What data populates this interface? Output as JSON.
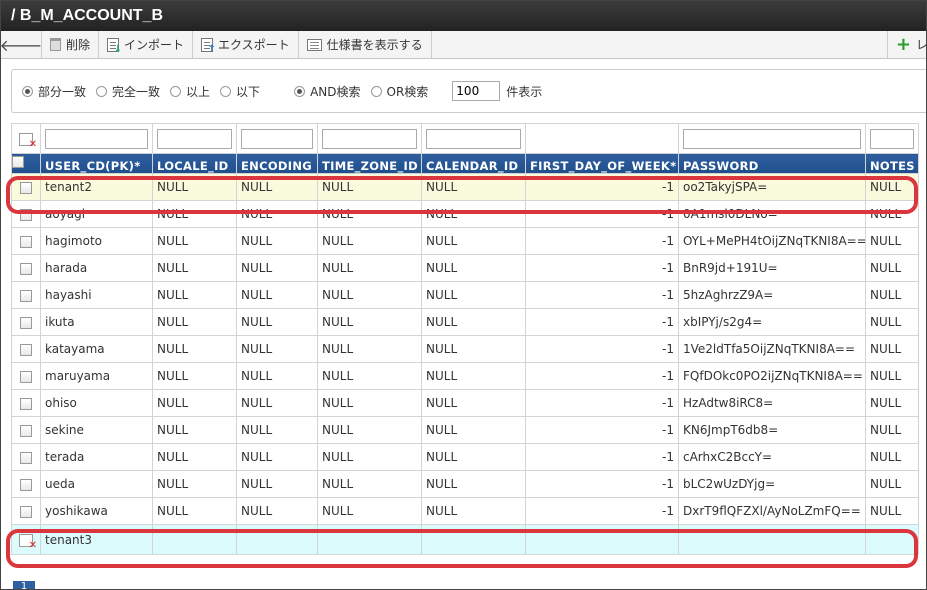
{
  "title": "/ B_M_ACCOUNT_B",
  "toolbar": {
    "delete": "削除",
    "import": "インポート",
    "export": "エクスポート",
    "spec": "仕様書を表示する",
    "add": "レ"
  },
  "search": {
    "options": [
      "部分一致",
      "完全一致",
      "以上",
      "以下"
    ],
    "logic": [
      "AND検索",
      "OR検索"
    ],
    "count_value": "100",
    "count_label": "件表示"
  },
  "columns": [
    "USER_CD(PK)*",
    "LOCALE_ID",
    "ENCODING",
    "TIME_ZONE_ID",
    "CALENDAR_ID",
    "FIRST_DAY_OF_WEEK*",
    "PASSWORD",
    "NOTES"
  ],
  "rows": [
    {
      "user": "tenant2",
      "locale": "NULL",
      "encoding": "NULL",
      "tz": "NULL",
      "cal": "NULL",
      "fdow": "-1",
      "password": "oo2TakyjSPA=",
      "notes": "NULL"
    },
    {
      "user": "aoyagi",
      "locale": "NULL",
      "encoding": "NULL",
      "tz": "NULL",
      "cal": "NULL",
      "fdow": "-1",
      "password": "0A1msl0DLNo=",
      "notes": "NULL"
    },
    {
      "user": "hagimoto",
      "locale": "NULL",
      "encoding": "NULL",
      "tz": "NULL",
      "cal": "NULL",
      "fdow": "-1",
      "password": "OYL+MePH4tOijZNqTKNI8A==",
      "notes": "NULL"
    },
    {
      "user": "harada",
      "locale": "NULL",
      "encoding": "NULL",
      "tz": "NULL",
      "cal": "NULL",
      "fdow": "-1",
      "password": "BnR9jd+191U=",
      "notes": "NULL"
    },
    {
      "user": "hayashi",
      "locale": "NULL",
      "encoding": "NULL",
      "tz": "NULL",
      "cal": "NULL",
      "fdow": "-1",
      "password": "5hzAghrzZ9A=",
      "notes": "NULL"
    },
    {
      "user": "ikuta",
      "locale": "NULL",
      "encoding": "NULL",
      "tz": "NULL",
      "cal": "NULL",
      "fdow": "-1",
      "password": "xbIPYj/s2g4=",
      "notes": "NULL"
    },
    {
      "user": "katayama",
      "locale": "NULL",
      "encoding": "NULL",
      "tz": "NULL",
      "cal": "NULL",
      "fdow": "-1",
      "password": "1Ve2ldTfa5OijZNqTKNI8A==",
      "notes": "NULL"
    },
    {
      "user": "maruyama",
      "locale": "NULL",
      "encoding": "NULL",
      "tz": "NULL",
      "cal": "NULL",
      "fdow": "-1",
      "password": "FQfDOkc0PO2ijZNqTKNI8A==",
      "notes": "NULL"
    },
    {
      "user": "ohiso",
      "locale": "NULL",
      "encoding": "NULL",
      "tz": "NULL",
      "cal": "NULL",
      "fdow": "-1",
      "password": "HzAdtw8iRC8=",
      "notes": "NULL"
    },
    {
      "user": "sekine",
      "locale": "NULL",
      "encoding": "NULL",
      "tz": "NULL",
      "cal": "NULL",
      "fdow": "-1",
      "password": "KN6JmpT6db8=",
      "notes": "NULL"
    },
    {
      "user": "terada",
      "locale": "NULL",
      "encoding": "NULL",
      "tz": "NULL",
      "cal": "NULL",
      "fdow": "-1",
      "password": "cArhxC2BccY=",
      "notes": "NULL"
    },
    {
      "user": "ueda",
      "locale": "NULL",
      "encoding": "NULL",
      "tz": "NULL",
      "cal": "NULL",
      "fdow": "-1",
      "password": "bLC2wUzDYjg=",
      "notes": "NULL"
    },
    {
      "user": "yoshikawa",
      "locale": "NULL",
      "encoding": "NULL",
      "tz": "NULL",
      "cal": "NULL",
      "fdow": "-1",
      "password": "DxrT9flQFZXl/AyNoLZmFQ==",
      "notes": "NULL"
    }
  ],
  "new_row": {
    "user": "tenant3"
  },
  "pager": {
    "page": "1"
  },
  "colors": {
    "accent": "#1f4e8c",
    "highlight": "#d9363e",
    "new_row_bg": "#dcfbfc",
    "selected_row_bg": "#fafadd"
  }
}
